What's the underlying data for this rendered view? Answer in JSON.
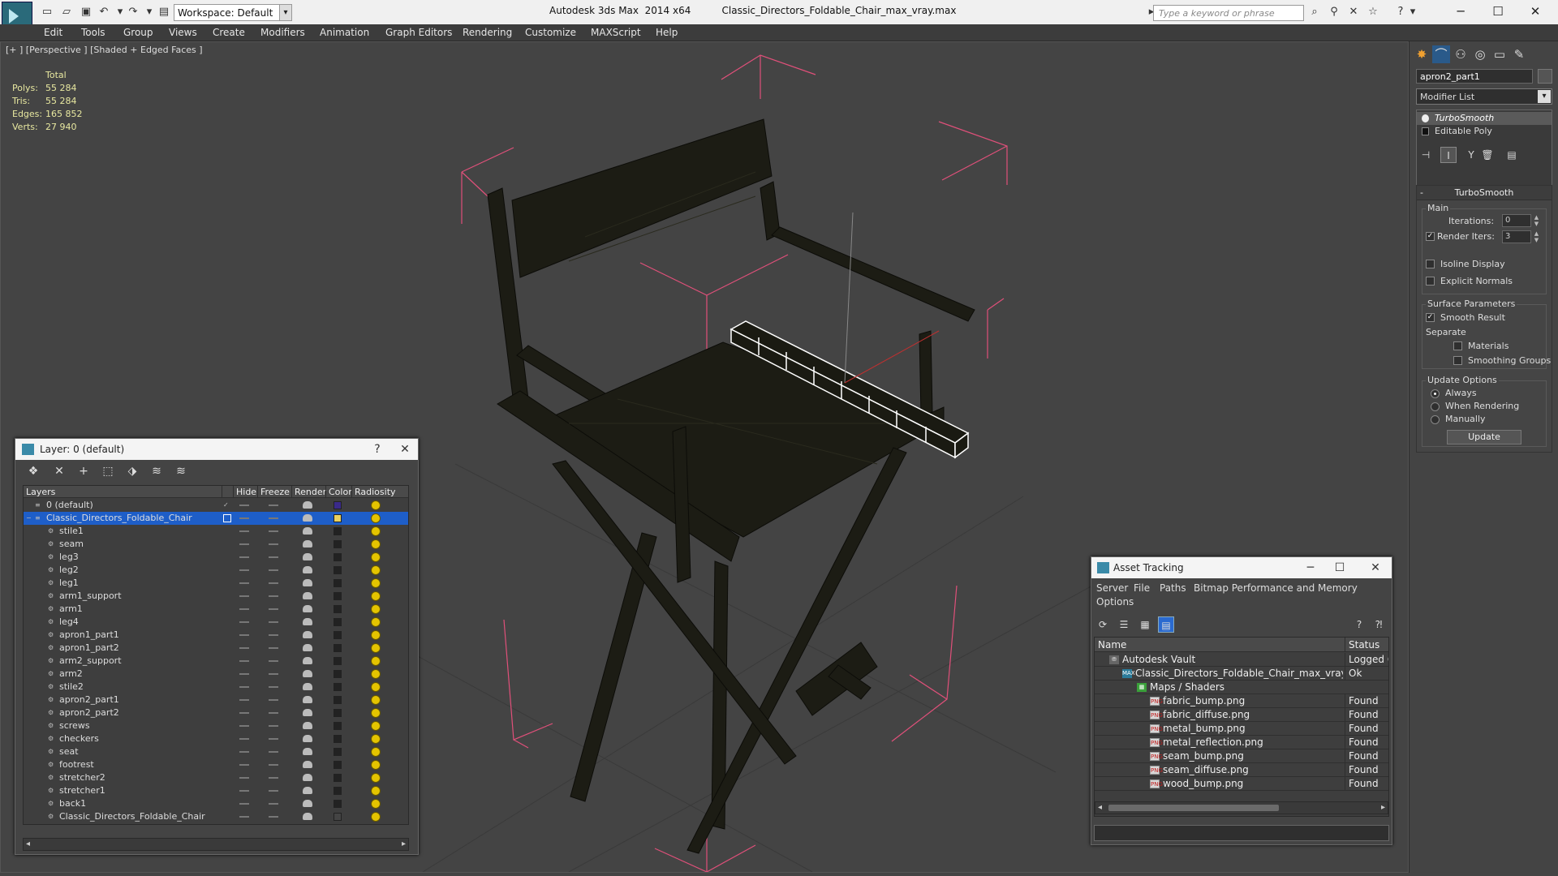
{
  "titlebar": {
    "workspace": "Workspace: Default",
    "app_title": "Autodesk 3ds Max  2014 x64",
    "file_title": "Classic_Directors_Foldable_Chair_max_vray.max",
    "search_placeholder": "Type a keyword or phrase"
  },
  "menu": [
    "Edit",
    "Tools",
    "Group",
    "Views",
    "Create",
    "Modifiers",
    "Animation",
    "Graph Editors",
    "Rendering",
    "Customize",
    "MAXScript",
    "Help"
  ],
  "viewport": {
    "label": "[+ ] [Perspective ] [Shaded + Edged Faces ]",
    "stats": {
      "header": "Total",
      "polys_label": "Polys:",
      "polys": "55 284",
      "tris_label": "Tris:",
      "tris": "55 284",
      "edges_label": "Edges:",
      "edges": "165 852",
      "verts_label": "Verts:",
      "verts": "27 940"
    }
  },
  "command_panel": {
    "object_name": "apron2_part1",
    "modifier_list": "Modifier List",
    "stack": [
      "TurboSmooth",
      "Editable Poly"
    ],
    "rollout_title": "TurboSmooth",
    "main_group": "Main",
    "iterations_label": "Iterations:",
    "iterations": "0",
    "render_iters_label": "Render Iters:",
    "render_iters": "3",
    "isoline_label": "Isoline Display",
    "explicit_normals_label": "Explicit Normals",
    "surface_group": "Surface Parameters",
    "smooth_result_label": "Smooth Result",
    "separate_label": "Separate",
    "materials_label": "Materials",
    "smoothing_groups_label": "Smoothing Groups",
    "update_group": "Update Options",
    "always_label": "Always",
    "when_rendering_label": "When Rendering",
    "manually_label": "Manually",
    "update_button": "Update"
  },
  "layer_dialog": {
    "title": "Layer: 0 (default)",
    "columns": [
      "Layers",
      "Hide",
      "Freeze",
      "Render",
      "Color",
      "Radiosity"
    ],
    "rows": [
      {
        "name": "0 (default)",
        "color": "#3a2a8a"
      },
      {
        "name": "Classic_Directors_Foldable_Chair",
        "color": "#e8d060"
      },
      {
        "name": "stile1",
        "color": "#222222"
      },
      {
        "name": "seam",
        "color": "#222222"
      },
      {
        "name": "leg3",
        "color": "#222222"
      },
      {
        "name": "leg2",
        "color": "#222222"
      },
      {
        "name": "leg1",
        "color": "#222222"
      },
      {
        "name": "arm1_support",
        "color": "#222222"
      },
      {
        "name": "arm1",
        "color": "#222222"
      },
      {
        "name": "leg4",
        "color": "#222222"
      },
      {
        "name": "apron1_part1",
        "color": "#222222"
      },
      {
        "name": "apron1_part2",
        "color": "#222222"
      },
      {
        "name": "arm2_support",
        "color": "#222222"
      },
      {
        "name": "arm2",
        "color": "#222222"
      },
      {
        "name": "stile2",
        "color": "#222222"
      },
      {
        "name": "apron2_part1",
        "color": "#222222"
      },
      {
        "name": "apron2_part2",
        "color": "#222222"
      },
      {
        "name": "screws",
        "color": "#222222"
      },
      {
        "name": "checkers",
        "color": "#222222"
      },
      {
        "name": "seat",
        "color": "#222222"
      },
      {
        "name": "footrest",
        "color": "#222222"
      },
      {
        "name": "stretcher2",
        "color": "#222222"
      },
      {
        "name": "stretcher1",
        "color": "#222222"
      },
      {
        "name": "back1",
        "color": "#222222"
      },
      {
        "name": "Classic_Directors_Foldable_Chair",
        "color": "#444444"
      }
    ]
  },
  "asset_dialog": {
    "title": "Asset Tracking",
    "menu": [
      "Server",
      "File",
      "Paths",
      "Bitmap Performance and Memory",
      "Options"
    ],
    "columns": [
      "Name",
      "Status"
    ],
    "rows": [
      {
        "name": "Autodesk Vault",
        "status": "Logged O",
        "icon": "vault"
      },
      {
        "name": "Classic_Directors_Foldable_Chair_max_vray.max",
        "status": "Ok",
        "icon": "max"
      },
      {
        "name": "Maps / Shaders",
        "status": "",
        "icon": "map"
      },
      {
        "name": "fabric_bump.png",
        "status": "Found",
        "icon": "png"
      },
      {
        "name": "fabric_diffuse.png",
        "status": "Found",
        "icon": "png"
      },
      {
        "name": "metal_bump.png",
        "status": "Found",
        "icon": "png"
      },
      {
        "name": "metal_reflection.png",
        "status": "Found",
        "icon": "png"
      },
      {
        "name": "seam_bump.png",
        "status": "Found",
        "icon": "png"
      },
      {
        "name": "seam_diffuse.png",
        "status": "Found",
        "icon": "png"
      },
      {
        "name": "wood_bump.png",
        "status": "Found",
        "icon": "png"
      }
    ]
  },
  "colors": {
    "selection": "#1e5ec8",
    "wire": "#1c1c14",
    "bbox": "#e0507a",
    "stats": "#e8e8a0"
  }
}
